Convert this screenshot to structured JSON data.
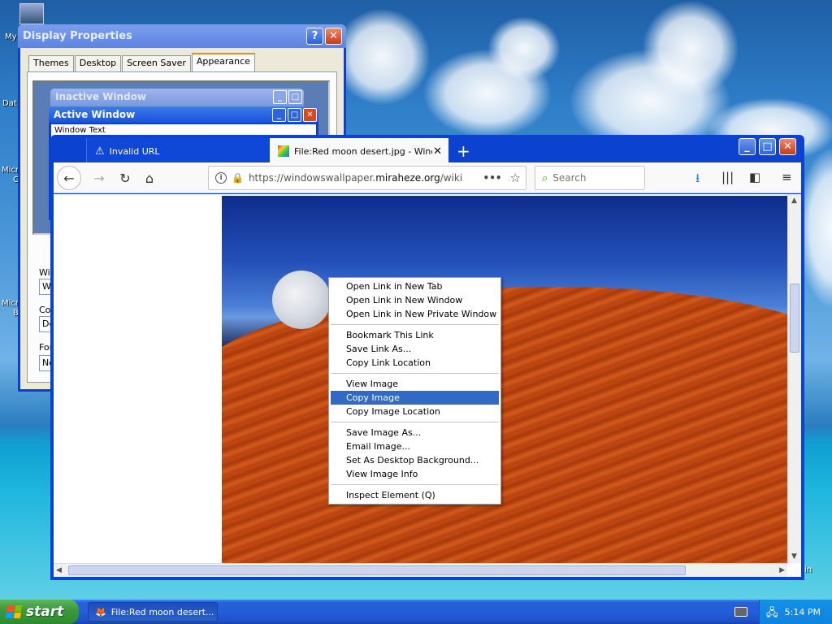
{
  "desktop": {
    "icon_labels": [
      "My",
      "Dat",
      "Micro",
      "C",
      "Micro",
      "B",
      "in"
    ]
  },
  "display_properties": {
    "title": "Display Properties",
    "help_btn": "?",
    "close_btn": "✕",
    "tabs": [
      "Themes",
      "Desktop",
      "Screen Saver",
      "Appearance"
    ],
    "selected_tab": "Appearance",
    "preview": {
      "inactive_title": "Inactive Window",
      "active_title": "Active Window",
      "window_text": "Window Text"
    },
    "labels": [
      "Win",
      "Col",
      "For"
    ],
    "fields": [
      "W",
      "De",
      "No"
    ]
  },
  "firefox": {
    "tabs": [
      {
        "title": "Invalid URL",
        "close": "✕"
      },
      {
        "title": "File:Red moon desert.jpg - Window",
        "close": "✕"
      }
    ],
    "new_tab": "+",
    "url_prefix": "https://windowswallpaper.",
    "url_host": "miraheze.org",
    "url_suffix": "/wiki",
    "page_actions": "•••",
    "search_placeholder": "Search"
  },
  "context_menu": {
    "groups": [
      [
        "Open Link in New Tab",
        "Open Link in New Window",
        "Open Link in New Private Window"
      ],
      [
        "Bookmark This Link",
        "Save Link As...",
        "Copy Link Location"
      ],
      [
        "View Image",
        "Copy Image",
        "Copy Image Location"
      ],
      [
        "Save Image As...",
        "Email Image...",
        "Set As Desktop Background...",
        "View Image Info"
      ],
      [
        "Inspect Element (Q)"
      ]
    ],
    "highlighted": "Copy Image"
  },
  "taskbar": {
    "start_label": "start",
    "task_item": "File:Red moon desert...",
    "clock": "5:14 PM"
  },
  "colors": {
    "xp_blue": "#0a3fcf",
    "menu_highlight": "#316ac5",
    "start_green": "#3c9a3c"
  }
}
